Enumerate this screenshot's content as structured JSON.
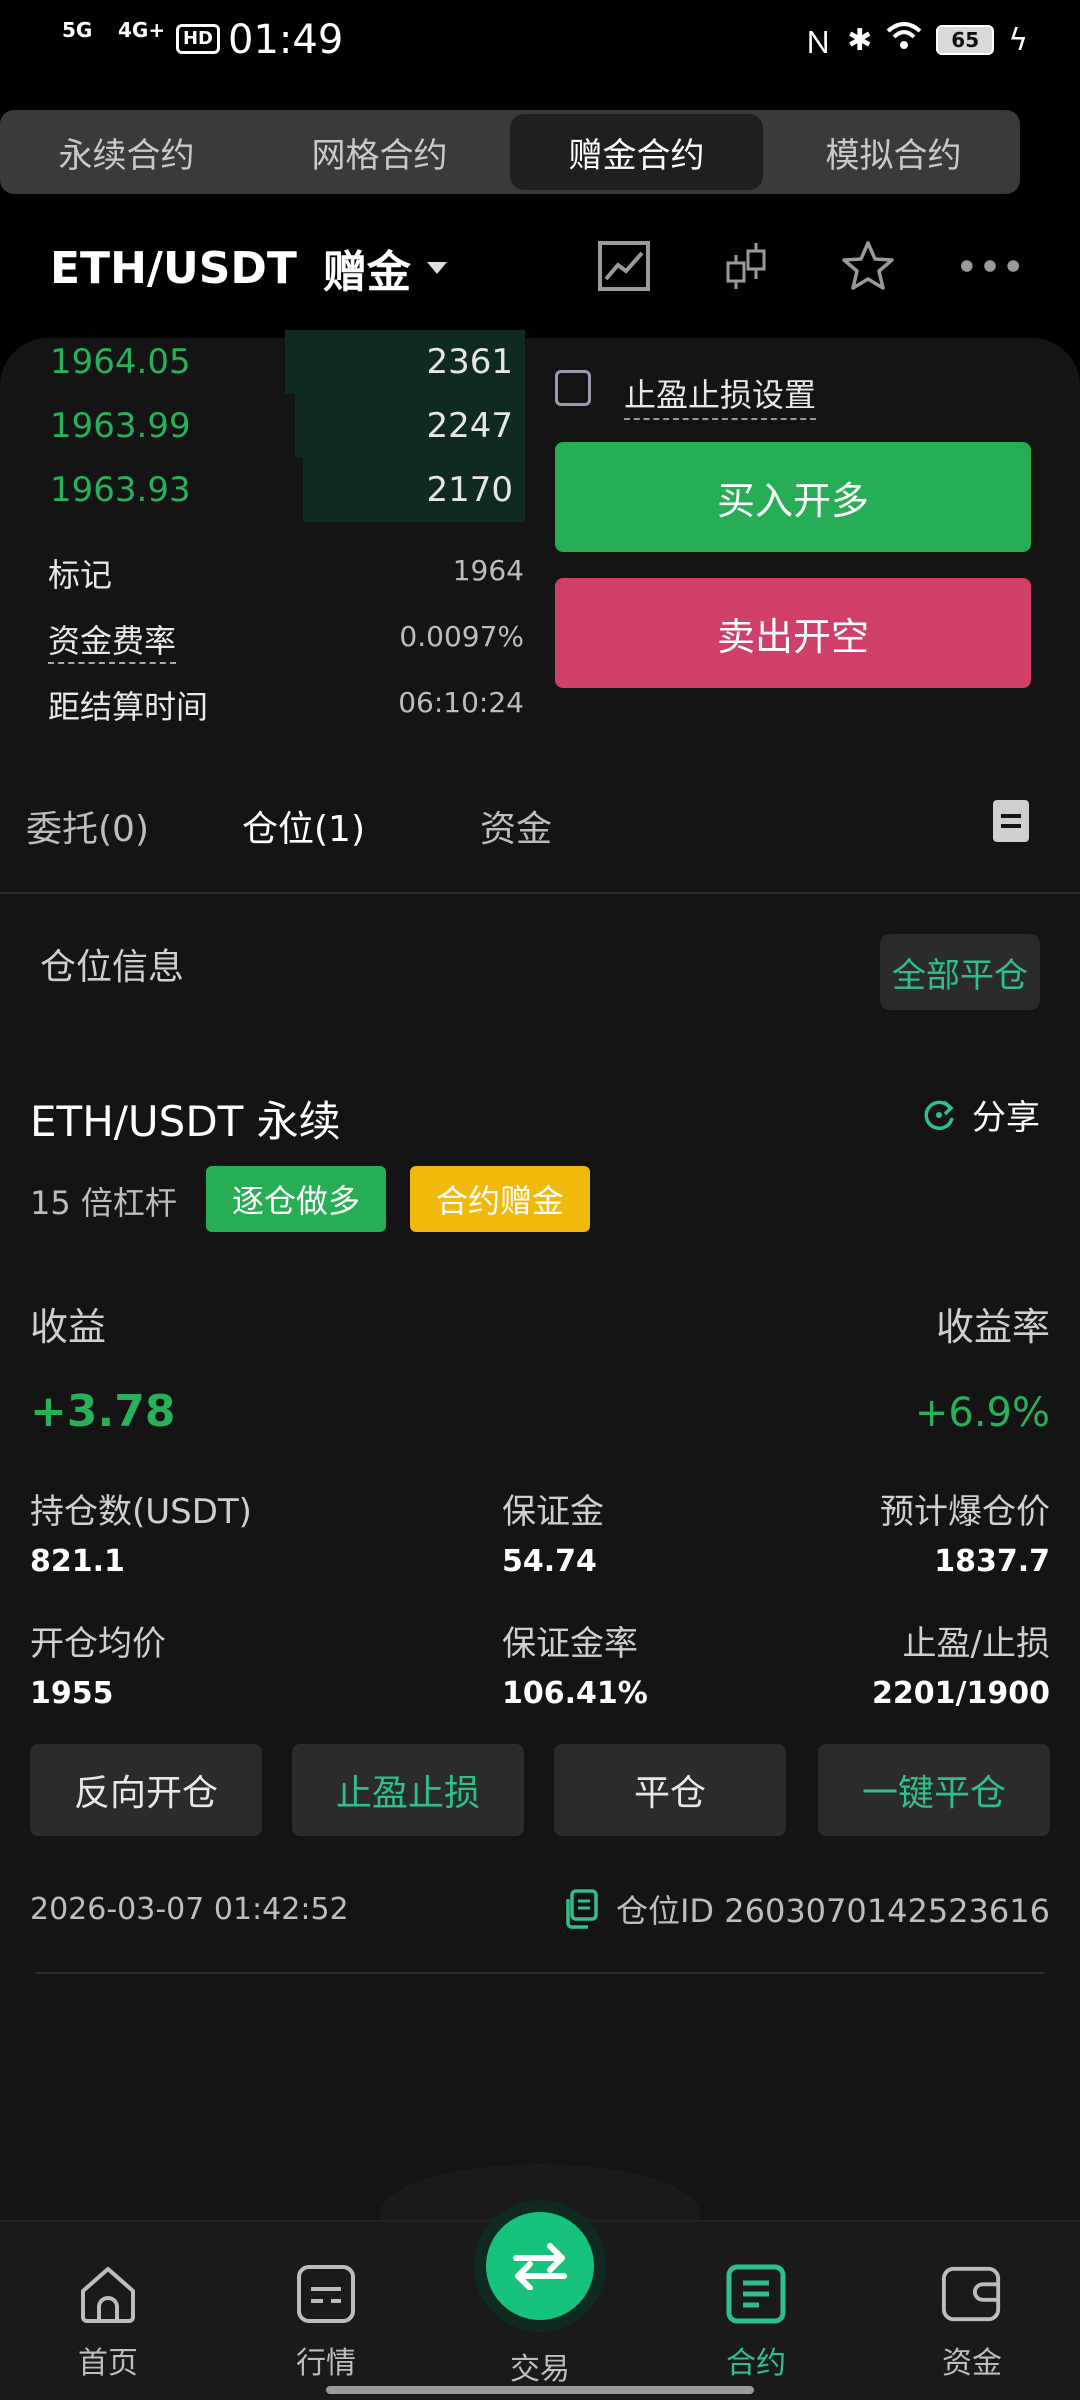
{
  "status_bar": {
    "net1": "5G",
    "net2": "4G+",
    "hd": "HD",
    "time": "01:49",
    "battery": "65"
  },
  "top_tabs": [
    "永续合约",
    "网格合约",
    "赠金合约",
    "模拟合约"
  ],
  "pair": {
    "symbol": "ETH/USDT",
    "type": "赠金"
  },
  "order_book": [
    {
      "price": "1964.05",
      "qty": "2361"
    },
    {
      "price": "1963.99",
      "qty": "2247"
    },
    {
      "price": "1963.93",
      "qty": "2170"
    }
  ],
  "market_info": {
    "mark_label": "标记",
    "mark_value": "1964",
    "funding_label": "资金费率",
    "funding_value": "0.0097%",
    "settle_label": "距结算时间",
    "settle_value": "06:10:24"
  },
  "order_panel": {
    "tp_sl_label": "止盈止损设置",
    "buy_label": "买入开多",
    "sell_label": "卖出开空"
  },
  "sub_tabs": {
    "orders": "委托(0)",
    "positions": "仓位(1)",
    "funds": "资金"
  },
  "position_section": {
    "title": "仓位信息",
    "close_all": "全部平仓"
  },
  "position": {
    "name": "ETH/USDT 永续",
    "share": "分享",
    "leverage": "15 倍杠杆",
    "tag_mode": "逐仓做多",
    "tag_bonus": "合约赠金",
    "pnl_label": "收益",
    "pnl_rate_label": "收益率",
    "pnl": "+3.78",
    "pnl_rate": "+6.9%",
    "size_label": "持仓数(USDT)",
    "size": "821.1",
    "margin_label": "保证金",
    "margin": "54.74",
    "liq_label": "预计爆仓价",
    "liq": "1837.7",
    "entry_label": "开仓均价",
    "entry": "1955",
    "margin_rate_label": "保证金率",
    "margin_rate": "106.41%",
    "tpsl_label": "止盈/止损",
    "tpsl": "2201/1900",
    "actions": [
      "反向开仓",
      "止盈止损",
      "平仓",
      "一键平仓"
    ],
    "time": "2026-03-07 01:42:52",
    "id": "仓位ID 2603070142523616"
  },
  "nav": {
    "home": "首页",
    "market": "行情",
    "trade": "交易",
    "contract": "合约",
    "assets": "资金"
  },
  "colors": {
    "green": "#27ae55",
    "red": "#cf3f68",
    "accent": "#2fc08a",
    "yellow": "#f2b90d"
  }
}
